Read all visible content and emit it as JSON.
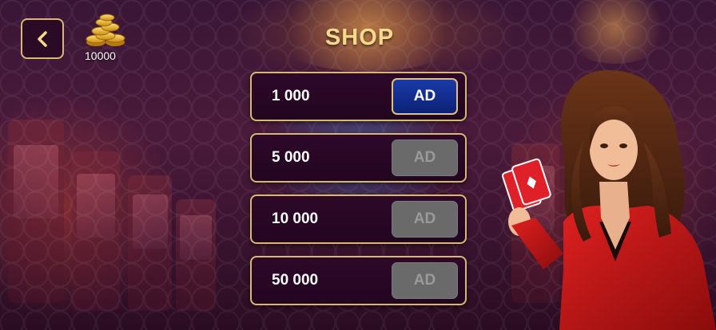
{
  "header": {
    "title": "SHOP",
    "coins": "10000",
    "back_icon": "chevron-left-icon",
    "coin_icon": "gold-coins-icon"
  },
  "shop": {
    "items": [
      {
        "amount": "1 000",
        "button": "AD",
        "state": "active"
      },
      {
        "amount": "5 000",
        "button": "AD",
        "state": "disabled"
      },
      {
        "amount": "10 000",
        "button": "AD",
        "state": "disabled"
      },
      {
        "amount": "50 000",
        "button": "AD",
        "state": "disabled"
      }
    ]
  },
  "colors": {
    "gold": "#d8b870",
    "title": "#f6d98c",
    "active_button": "#1a3aa8",
    "disabled_button": "#6a6a6a",
    "row_bg": "#2e0829"
  }
}
